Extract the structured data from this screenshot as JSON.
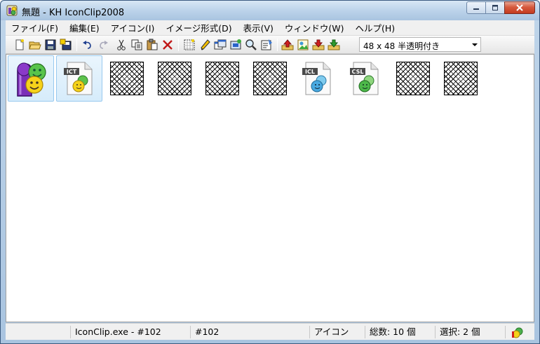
{
  "window": {
    "title": "無題 - KH IconClip2008"
  },
  "menu": [
    "ファイル(F)",
    "編集(E)",
    "アイコン(I)",
    "イメージ形式(D)",
    "表示(V)",
    "ウィンドウ(W)",
    "ヘルプ(H)"
  ],
  "toolbar": {
    "buttons": [
      "new-file-icon",
      "open-folder-icon",
      "save-icon",
      "save-all-icon",
      "undo-icon",
      "redo-icon",
      "cut-icon",
      "copy-icon",
      "paste-icon",
      "delete-icon",
      "select-grid-icon",
      "pencil-icon",
      "copy-window-icon",
      "export-icon",
      "zoom-icon",
      "properties-icon",
      "upload-icon",
      "image-icon",
      "import-icon",
      "download-icon"
    ],
    "format_select": "48 x 48 半透明付き"
  },
  "icons": [
    {
      "kind": "app",
      "label": "",
      "selected": true
    },
    {
      "kind": "file",
      "label": "ICT",
      "selected": true
    },
    {
      "kind": "empty",
      "selected": false
    },
    {
      "kind": "empty",
      "selected": false
    },
    {
      "kind": "empty",
      "selected": false
    },
    {
      "kind": "empty",
      "selected": false
    },
    {
      "kind": "file",
      "label": "ICL",
      "selected": false
    },
    {
      "kind": "file",
      "label": "CSL",
      "selected": false
    },
    {
      "kind": "empty",
      "selected": false
    },
    {
      "kind": "empty",
      "selected": false
    }
  ],
  "status": {
    "source": "IconClip.exe - #102",
    "resource": "#102",
    "type": "アイコン",
    "total": "総数: 10 個",
    "selected": "選択: 2 個"
  },
  "colors": {
    "accent": "#98c9ef",
    "close_button": "#c43a1e"
  }
}
